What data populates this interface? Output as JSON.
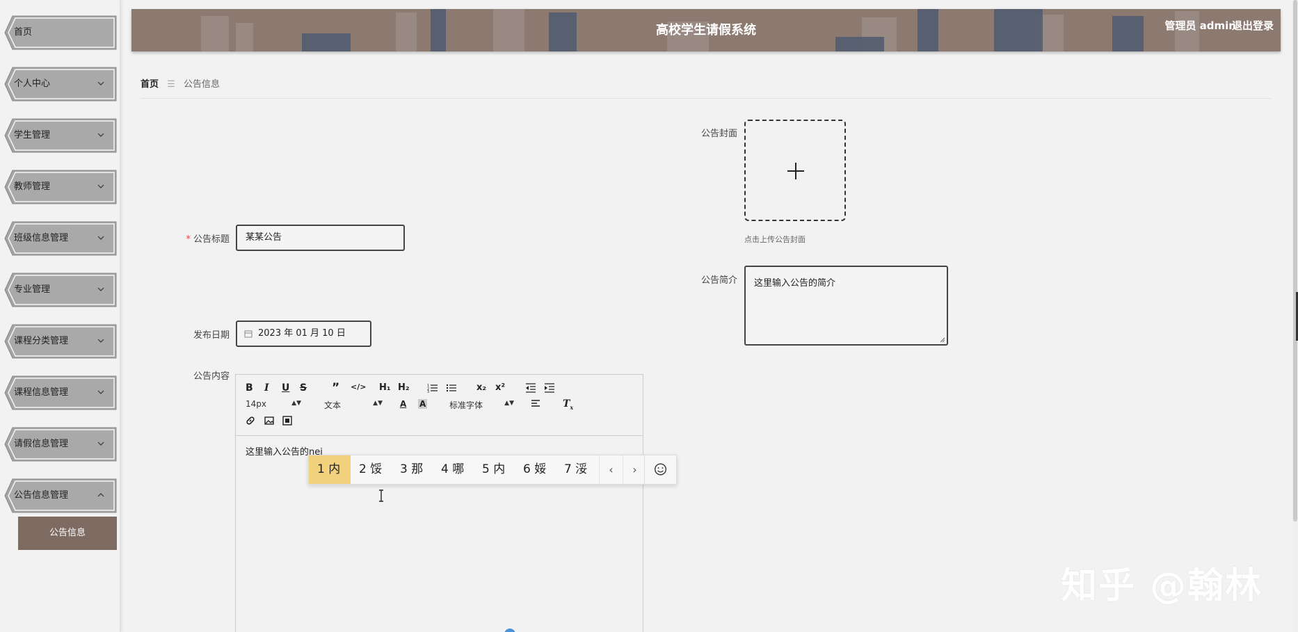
{
  "header": {
    "title": "高校学生请假系统",
    "user_label": "管理员 admin",
    "logout_label": "退出登录"
  },
  "sidebar": {
    "items": [
      {
        "label": "首页",
        "has_arrow": false
      },
      {
        "label": "个人中心",
        "has_arrow": true
      },
      {
        "label": "学生管理",
        "has_arrow": true
      },
      {
        "label": "教师管理",
        "has_arrow": true
      },
      {
        "label": "班级信息管理",
        "has_arrow": true
      },
      {
        "label": "专业管理",
        "has_arrow": true
      },
      {
        "label": "课程分类管理",
        "has_arrow": true
      },
      {
        "label": "课程信息管理",
        "has_arrow": true
      },
      {
        "label": "请假信息管理",
        "has_arrow": true
      },
      {
        "label": "公告信息管理",
        "has_arrow": true,
        "expanded": true
      }
    ],
    "sub_item": "公告信息"
  },
  "breadcrumb": {
    "home": "首页",
    "current": "公告信息"
  },
  "form": {
    "cover_label": "公告封面",
    "cover_hint": "点击上传公告封面",
    "title_label": "公告标题",
    "title_value": "某某公告",
    "summary_label": "公告简介",
    "summary_value": "这里输入公告的简介",
    "date_label": "发布日期",
    "date_value": "2023 年 01 月 10 日",
    "content_label": "公告内容"
  },
  "editor": {
    "font_size": "14px",
    "paragraph": "文本",
    "font_family": "标准字体",
    "content": "这里输入公告的",
    "composing": "nei"
  },
  "ime": {
    "candidates": [
      "1 内",
      "2 馁",
      "3 那",
      "4 哪",
      "5 内",
      "6 娞",
      "7 浽"
    ],
    "prev": "‹",
    "next": "›"
  },
  "watermark": "知乎 @翰林",
  "colors": {
    "header_bg": "#8c7a70",
    "active_sub": "#7d6a60",
    "ime_active": "#f3d27e"
  }
}
